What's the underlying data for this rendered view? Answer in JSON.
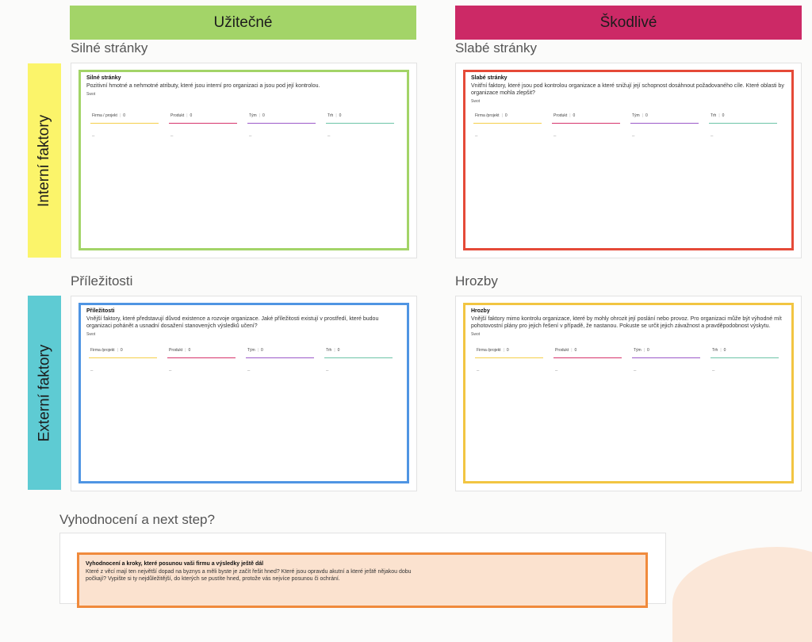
{
  "columns": {
    "helpful": {
      "label": "Užitečné",
      "color": "#a3d468"
    },
    "harmful": {
      "label": "Škodlivé",
      "color": "#cc2966"
    }
  },
  "rows": {
    "internal": {
      "label": "Interní faktory",
      "color": "#fbf46a"
    },
    "external": {
      "label": "Externí faktory",
      "color": "#5ecbd3"
    }
  },
  "sections": {
    "strengths": {
      "title": "Silné stránky",
      "card_title": "Silné stránky",
      "card_desc": "Pozitivní hmotné a nehmotné atributy, které jsou interní pro organizaci a jsou pod její kontrolou.",
      "swot": "Swot",
      "border": "#a3d468",
      "metrics": [
        {
          "label": "Firma / projekt",
          "value": "0",
          "dash": "–"
        },
        {
          "label": "Produkt",
          "value": "0",
          "dash": "–"
        },
        {
          "label": "Tým",
          "value": "0",
          "dash": "–"
        },
        {
          "label": "Trh",
          "value": "0",
          "dash": "–"
        }
      ]
    },
    "weaknesses": {
      "title": "Slabé stránky",
      "card_title": "Slabé stránky",
      "card_desc": "Vnitřní faktory, které jsou pod kontrolou organizace a které snižují její schopnost dosáhnout požadovaného cíle. Které oblasti by organizace mohla zlepšit?",
      "swot": "Swot",
      "border": "#e54a38",
      "metrics": [
        {
          "label": "Firma /projekt",
          "value": "0",
          "dash": "–"
        },
        {
          "label": "Produkt",
          "value": "0",
          "dash": "–"
        },
        {
          "label": "Tým",
          "value": "0",
          "dash": "–"
        },
        {
          "label": "Trh",
          "value": "0",
          "dash": "–"
        }
      ]
    },
    "opportunities": {
      "title": "Příležitosti",
      "card_title": "Příležitosti",
      "card_desc": "Vnější faktory, které představují důvod existence a rozvoje organizace. Jaké příležitosti existují v prostředí, které budou organizaci pohánět a usnadní dosažení stanovených výsledků učení?",
      "swot": "Swot",
      "border": "#4f95e3",
      "metrics": [
        {
          "label": "Firma /projekt",
          "value": "0",
          "dash": "–"
        },
        {
          "label": "Produkt",
          "value": "0",
          "dash": "–"
        },
        {
          "label": "Tým",
          "value": "0",
          "dash": "–"
        },
        {
          "label": "Trh",
          "value": "0",
          "dash": "–"
        }
      ]
    },
    "threats": {
      "title": "Hrozby",
      "card_title": "Hrozby",
      "card_desc": "Vnější faktory mimo kontrolu organizace, které by mohly ohrozit její poslání nebo provoz. Pro organizaci může být výhodné mít pohotovostní plány pro jejich řešení v případě, že nastanou. Pokuste se určit jejich závažnost a pravděpodobnost výskytu.",
      "swot": "Swot",
      "border": "#f2c542",
      "metrics": [
        {
          "label": "Firma /projekt",
          "value": "0",
          "dash": "–"
        },
        {
          "label": "Produkt",
          "value": "0",
          "dash": "–"
        },
        {
          "label": "Tým",
          "value": "0",
          "dash": "–"
        },
        {
          "label": "Trh",
          "value": "0",
          "dash": "–"
        }
      ]
    }
  },
  "metric_colors": [
    "#f5cf4a",
    "#d6336c",
    "#9b59c9",
    "#6dc4a7"
  ],
  "evaluation": {
    "title": "Vyhodnocení a next step?",
    "card_title": "Vyhodnocení a kroky, které posunou vaši firmu a výsledky ještě dál",
    "card_desc": "Které z věcí mají ten největší dopad na byznys a měli byste je začít řešit hned? Které jsou opravdu akutní a které ještě nějakou dobu počkají? Vypište si ty nejdůležitější, do kterých se pustíte hned, protože vás nejvíce posunou či ochrání.",
    "border": "#f08a3c",
    "bg": "#fbe2cf"
  }
}
